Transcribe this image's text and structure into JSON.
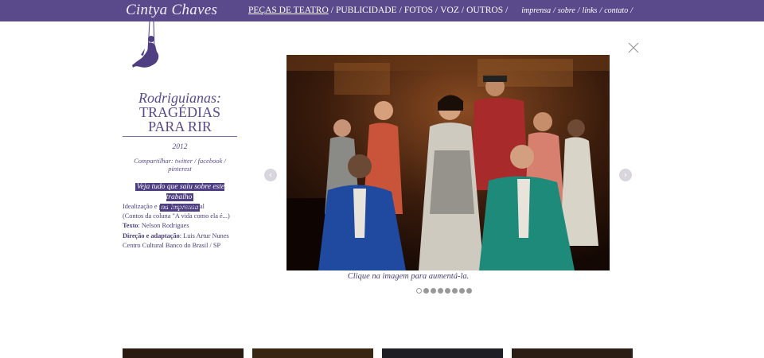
{
  "header": {
    "logo": "Cintya Chaves",
    "nav": [
      {
        "label": "PEÇAS DE TEATRO",
        "active": true
      },
      {
        "label": "PUBLICIDADE"
      },
      {
        "label": "FOTOS"
      },
      {
        "label": "VOZ"
      },
      {
        "label": "OUTROS"
      }
    ],
    "nav_sep": "/",
    "subnav": [
      "imprensa",
      "sobre",
      "links",
      "contato"
    ],
    "subnav_sep": "/"
  },
  "work": {
    "title_line1": "Rodriguianas:",
    "title_line2": "TRAGÉDIAS PARA RIR",
    "year": "2012",
    "share_label": "Compartilhar: ",
    "share_links": [
      "twitter",
      "facebook",
      "pinterest"
    ],
    "share_sep": " / ",
    "press_line1": "Veja tudo que saiu sobre este trabalho",
    "press_line2": "na imprensa",
    "credits": {
      "line1": "Idealização e produção pessoal",
      "line2": "(Contos da coluna \"A vida como ela é...)",
      "text_label": "Texto",
      "text_value": ": Nelson Rodrigues",
      "direction_label": "Direção e adaptação",
      "direction_value": ": Luis Artur Nunes",
      "venue": "Centro Cultural Banco do Brasil / SP"
    }
  },
  "gallery": {
    "caption": "Clique na imagem para aumentá-la.",
    "prev_icon": "chevron-left-icon",
    "next_icon": "chevron-right-icon",
    "prev_glyph": "‹",
    "next_glyph": "›",
    "slide_count": 8,
    "active_slide": 1
  },
  "colors": {
    "brand": "#5b4a8b",
    "text": "#4a3d7a",
    "press_bg": "#4f3f82"
  }
}
